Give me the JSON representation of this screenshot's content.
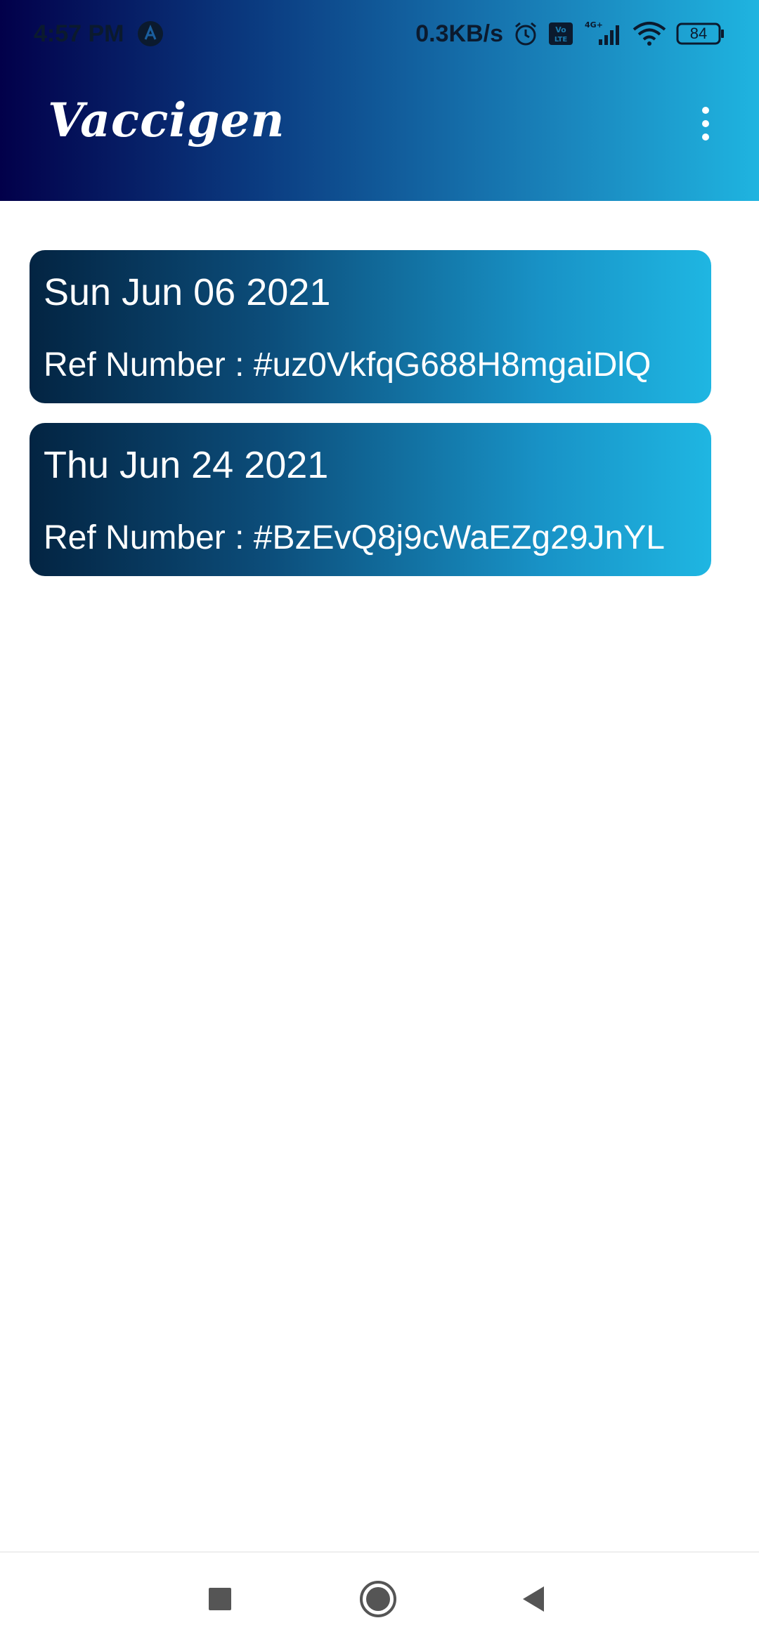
{
  "status_bar": {
    "time": "4:57 PM",
    "network_speed": "0.3KB/s",
    "signal_label": "4G+",
    "volte_label": "Vo LTE",
    "battery": "84",
    "icons": [
      "notification-a-icon",
      "alarm-icon",
      "volte-icon",
      "signal-icon",
      "wifi-icon",
      "battery-icon"
    ]
  },
  "app_bar": {
    "title": "Vaccigen",
    "menu_icon": "more-vert-icon"
  },
  "appointments": [
    {
      "date": "Sun Jun 06 2021",
      "ref": "Ref Number : #uz0VkfqG688H8mgaiDlQ"
    },
    {
      "date": "Thu Jun 24 2021",
      "ref": "Ref Number : #BzEvQ8j9cWaEZg29JnYL"
    }
  ],
  "nav_bar": {
    "icons": [
      "recents-square-icon",
      "home-circle-icon",
      "back-triangle-icon"
    ]
  },
  "colors": {
    "header_gradient_start": "#02004a",
    "header_gradient_end": "#1fb4e0",
    "card_gradient_start": "#032442",
    "card_gradient_end": "#1fb6e2"
  }
}
